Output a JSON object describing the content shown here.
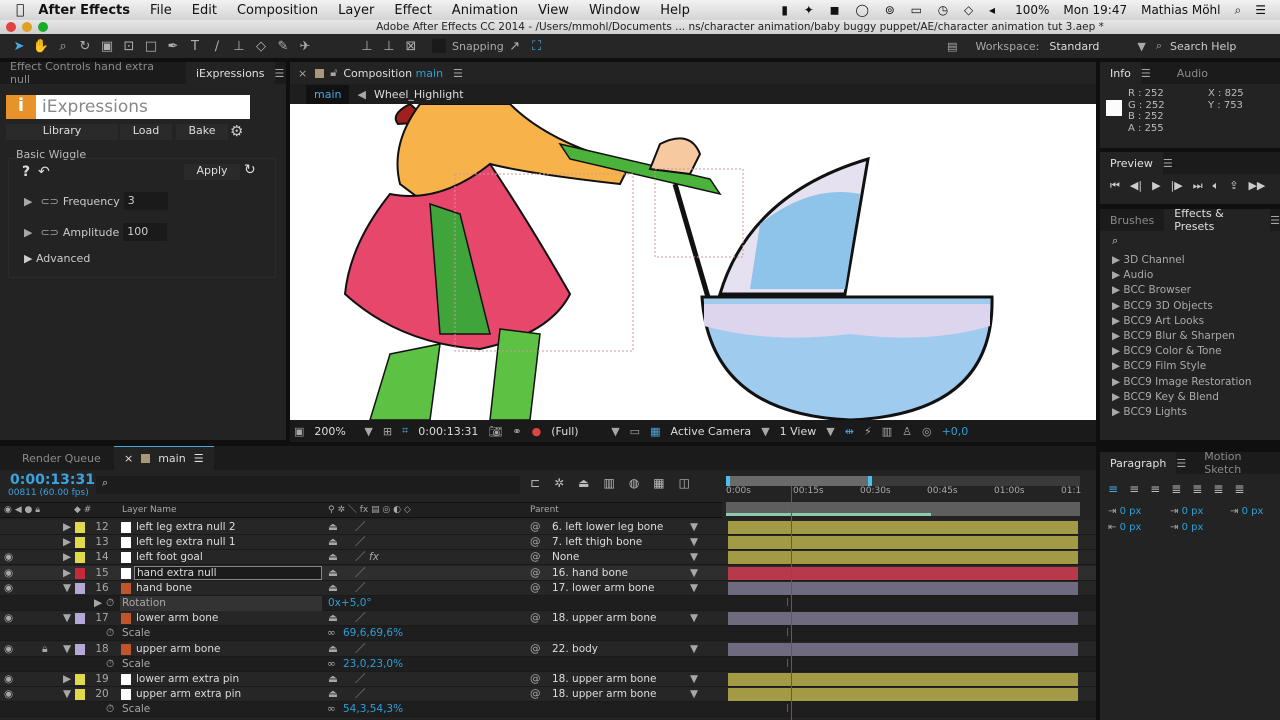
{
  "menubar": {
    "app": "After Effects",
    "items": [
      "File",
      "Edit",
      "Composition",
      "Layer",
      "Effect",
      "Animation",
      "View",
      "Window",
      "Help"
    ],
    "battery": "100%",
    "clock": "Mon 19:47",
    "user": "Mathias Möhl"
  },
  "titlebar": {
    "title": "Adobe After Effects CC 2014 - /Users/mmohl/Documents ... ns/character animation/baby buggy puppet/AE/character animation tut 3.aep *"
  },
  "toolbar": {
    "snapping": "Snapping",
    "workspace_label": "Workspace:",
    "workspace": "Standard",
    "search_help": "Search Help"
  },
  "left_panel": {
    "tab1": "Effect Controls hand extra null",
    "tab2": "iExpressions",
    "logo": "iExpressions",
    "library": "Library",
    "load": "Load",
    "bake": "Bake",
    "section": "Basic Wiggle",
    "apply": "Apply",
    "params": [
      {
        "label": "Frequency",
        "value": "3"
      },
      {
        "label": "Amplitude",
        "value": "100"
      }
    ],
    "advanced": "Advanced"
  },
  "comp": {
    "tab_prefix": "Composition",
    "tab_name": "main",
    "breadcrumb": [
      "main",
      "Wheel_Highlight"
    ],
    "zoom": "200%",
    "timecode": "0:00:13:31",
    "resolution": "(Full)",
    "camera": "Active Camera",
    "views": "1 View",
    "exposure": "+0,0"
  },
  "info": {
    "tab1": "Info",
    "tab2": "Audio",
    "r": "R : 252",
    "g": "G : 252",
    "b": "B : 252",
    "a": "A : 255",
    "x": "X : 825",
    "y": "Y : 753"
  },
  "preview": {
    "tab": "Preview"
  },
  "effects": {
    "tab1": "Brushes",
    "tab2": "Effects & Presets",
    "items": [
      "3D Channel",
      "Audio",
      "BCC Browser",
      "BCC9 3D Objects",
      "BCC9 Art Looks",
      "BCC9 Blur & Sharpen",
      "BCC9 Color & Tone",
      "BCC9 Film Style",
      "BCC9 Image Restoration",
      "BCC9 Key & Blend",
      "BCC9 Lights"
    ]
  },
  "timeline": {
    "tab_render": "Render Queue",
    "tab_main": "main",
    "timecode": "0:00:13:31",
    "frames": "00811 (60.00 fps)",
    "col_name": "Layer Name",
    "col_parent": "Parent",
    "ruler": [
      "0:00s",
      "00:15s",
      "00:30s",
      "00:45s",
      "01:00s",
      "01:1"
    ],
    "playhead_fraction": 0.18,
    "rows": [
      {
        "t": "layer",
        "num": "12",
        "name": "left leg extra null 2",
        "color": "#e0d94a",
        "parent": "6. left lower leg bone",
        "eye": false,
        "exp": false,
        "icon": "solid"
      },
      {
        "t": "layer",
        "num": "13",
        "name": "left leg extra null 1",
        "color": "#e0d94a",
        "parent": "7. left thigh bone",
        "eye": false,
        "exp": false,
        "icon": "solid"
      },
      {
        "t": "layer",
        "num": "14",
        "name": "left foot goal",
        "color": "#e0d94a",
        "parent": "None",
        "eye": true,
        "exp": false,
        "icon": "solid",
        "fx": true
      },
      {
        "t": "layer",
        "num": "15",
        "name": "hand extra null",
        "color": "#c8283c",
        "parent": "16. hand bone",
        "eye": true,
        "exp": false,
        "icon": "solid",
        "sel": true
      },
      {
        "t": "layer",
        "num": "16",
        "name": "hand bone",
        "color": "#b4a8d8",
        "parent": "17. lower arm bone",
        "eye": true,
        "exp": true,
        "icon": "ai"
      },
      {
        "t": "prop",
        "name": "Rotation",
        "value": "0x+5,0°",
        "hl": true
      },
      {
        "t": "layer",
        "num": "17",
        "name": "lower arm bone",
        "color": "#b4a8d8",
        "parent": "18. upper arm bone",
        "eye": true,
        "exp": true,
        "icon": "ai"
      },
      {
        "t": "prop",
        "name": "Scale",
        "value": "69,6,69,6%"
      },
      {
        "t": "layer",
        "num": "18",
        "name": "upper arm bone",
        "color": "#b4a8d8",
        "parent": "22. body",
        "eye": true,
        "exp": true,
        "icon": "ai",
        "lock": true
      },
      {
        "t": "prop",
        "name": "Scale",
        "value": "23,0,23,0%"
      },
      {
        "t": "layer",
        "num": "19",
        "name": "lower arm extra pin",
        "color": "#e0d94a",
        "parent": "18. upper arm bone",
        "eye": true,
        "exp": false,
        "icon": "solid"
      },
      {
        "t": "layer",
        "num": "20",
        "name": "upper arm extra pin",
        "color": "#e0d94a",
        "parent": "18. upper arm bone",
        "eye": true,
        "exp": true,
        "icon": "solid"
      },
      {
        "t": "prop",
        "name": "Scale",
        "value": "54,3,54,3%"
      }
    ]
  },
  "paragraph": {
    "tab1": "Paragraph",
    "tab2": "Motion Sketch",
    "values": [
      "0 px",
      "0 px",
      "0 px",
      "0 px",
      "0 px"
    ]
  }
}
